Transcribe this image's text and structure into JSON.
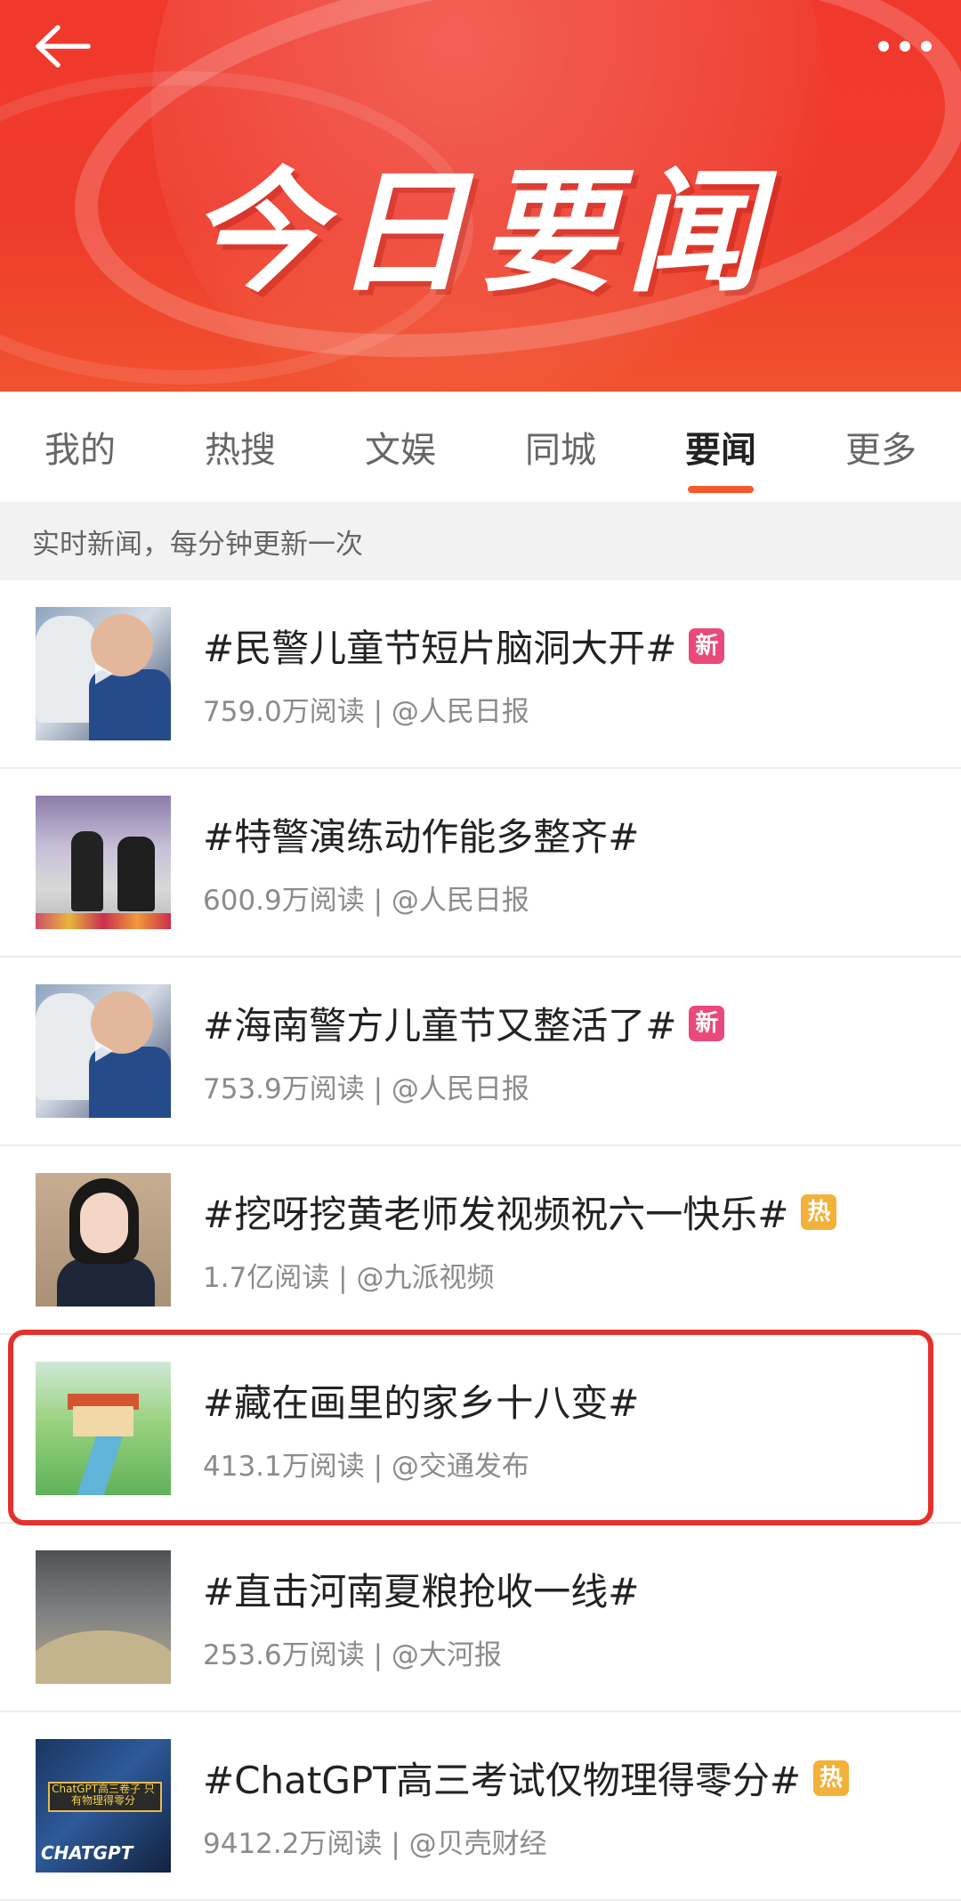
{
  "header": {
    "title": "今日要闻",
    "back_icon": "arrow-left-icon",
    "more_icon": "ellipsis-icon"
  },
  "tabs": [
    {
      "label": "我的",
      "active": false
    },
    {
      "label": "热搜",
      "active": false
    },
    {
      "label": "文娱",
      "active": false
    },
    {
      "label": "同城",
      "active": false
    },
    {
      "label": "要闻",
      "active": true
    },
    {
      "label": "更多",
      "active": false
    }
  ],
  "notice": "实时新闻，每分钟更新一次",
  "items": [
    {
      "title": "#民警儿童节短片脑洞大开#",
      "badge": "新",
      "meta": "759.0万阅读 | @人民日报"
    },
    {
      "title": "#特警演练动作能多整齐#",
      "badge": "",
      "meta": "600.9万阅读 | @人民日报"
    },
    {
      "title": "#海南警方儿童节又整活了#",
      "badge": "新",
      "meta": "753.9万阅读 | @人民日报"
    },
    {
      "title": "#挖呀挖黄老师发视频祝六一快乐#",
      "badge": "热",
      "meta": "1.7亿阅读 | @九派视频"
    },
    {
      "title": "#藏在画里的家乡十八变#",
      "badge": "",
      "meta": "413.1万阅读 | @交通发布"
    },
    {
      "title": "#直击河南夏粮抢收一线#",
      "badge": "",
      "meta": "253.6万阅读 | @大河报"
    },
    {
      "title": "#ChatGPT高三考试仅物理得零分#",
      "badge": "热",
      "meta": "9412.2万阅读 | @贝壳财经"
    }
  ],
  "thumb_text": {
    "chat_sign": "ChatGPT高三卷子 只有物理得零分",
    "chat_logo": "CHATGPT"
  },
  "colors": {
    "banner": "#ee3a2b",
    "accent": "#f35a2c",
    "badge_new": "#e9497b",
    "badge_hot": "#f3b13a",
    "highlight": "#e4312c"
  }
}
